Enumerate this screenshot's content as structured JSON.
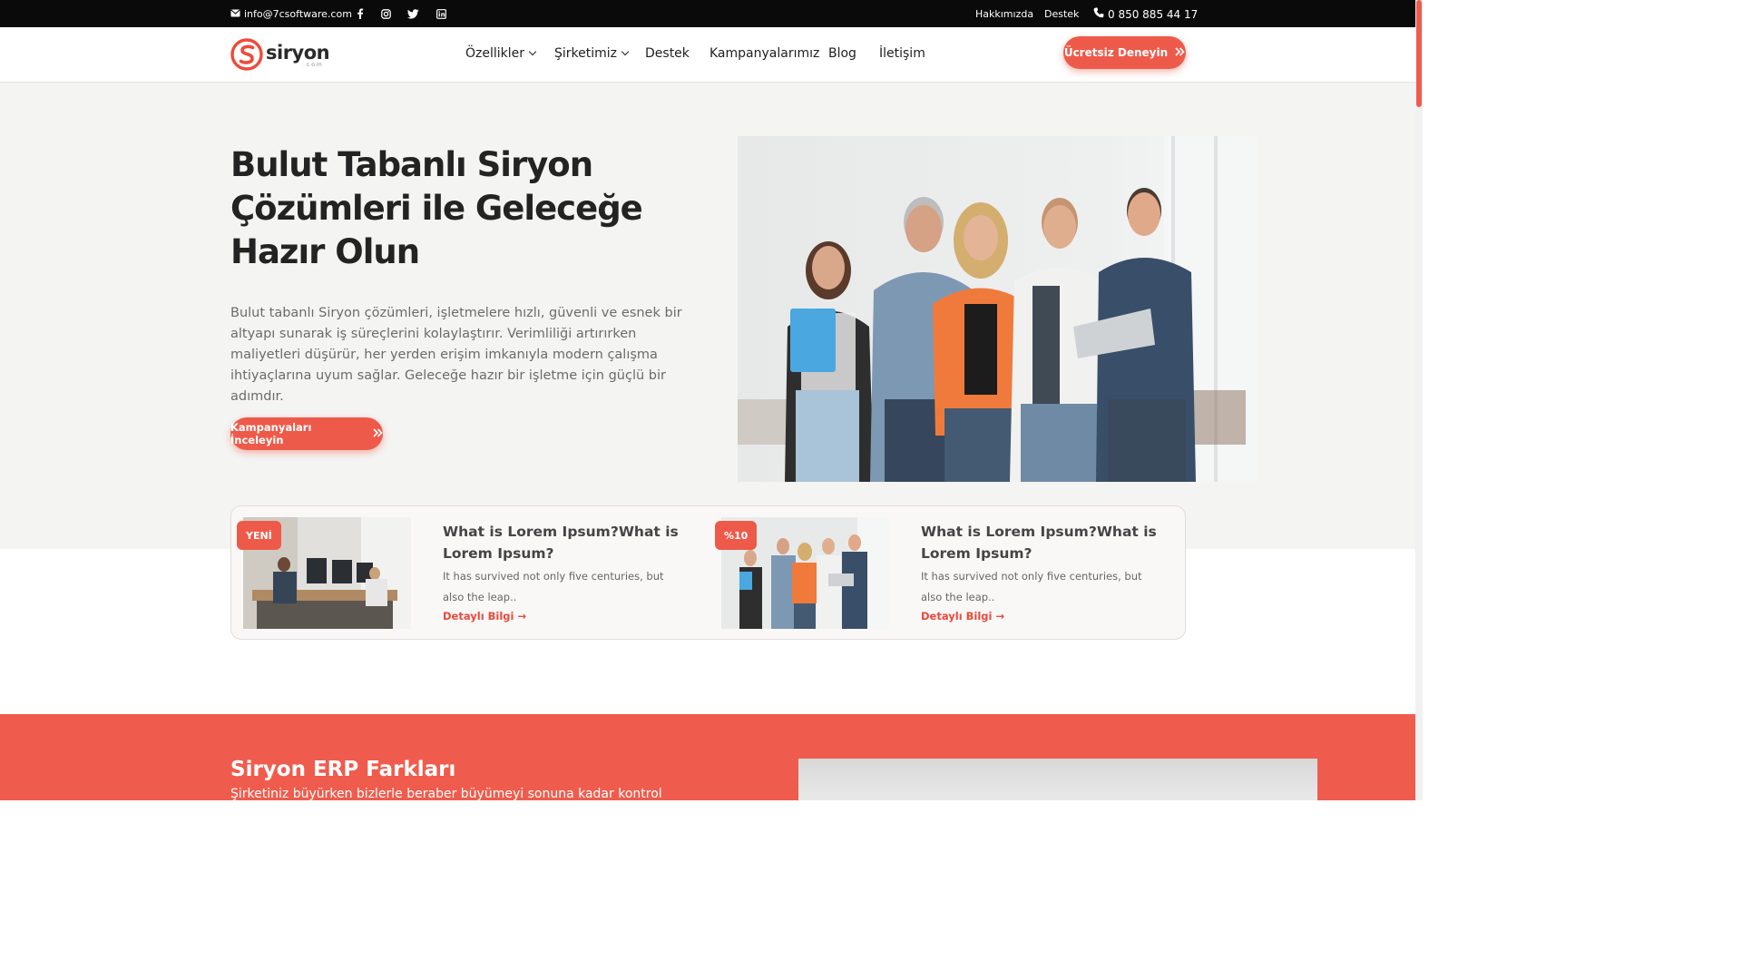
{
  "topbar": {
    "email": "info@7csoftware.com",
    "social": [
      "facebook-icon",
      "instagram-icon",
      "twitter-icon",
      "linkedin-icon"
    ],
    "links": [
      "Hakkımızda",
      "Destek"
    ],
    "phone": "0 850 885 44 17"
  },
  "header": {
    "logo_text": "siryon",
    "logo_sub": ".com",
    "nav": [
      {
        "label": "Özellikler",
        "dropdown": true
      },
      {
        "label": "Şirketimiz",
        "dropdown": true
      },
      {
        "label": "Destek",
        "dropdown": false
      },
      {
        "label": "Kampanyalarımız",
        "dropdown": false
      },
      {
        "label": "Blog",
        "dropdown": false
      },
      {
        "label": "İletişim",
        "dropdown": false
      }
    ],
    "cta": "Ücretsiz Deneyin"
  },
  "hero": {
    "title": "Bulut Tabanlı Siryon Çözümleri ile Geleceğe Hazır Olun",
    "description": "Bulut tabanlı Siryon çözümleri, işletmelere hızlı, güvenli ve esnek bir altyapı sunarak iş süreçlerini kolaylaştırır. Verimliliği artırırken maliyetleri düşürür, her yerden erişim imkanıyla modern çalışma ihtiyaçlarına uyum sağlar. Geleceğe hazır bir işletme için güçlü bir adımdır.",
    "cta": "Kampanyaları İnceleyin"
  },
  "cards": [
    {
      "badge": "YENİ",
      "title": "What is Lorem Ipsum?What is Lorem Ipsum?",
      "description": "It has survived not only five centuries, but also the leap..",
      "link": "Detaylı Bilgi →"
    },
    {
      "badge": "%10",
      "title": "What is Lorem Ipsum?What is Lorem Ipsum?",
      "description": "It has survived not only five centuries, but also the leap..",
      "link": "Detaylı Bilgi →"
    }
  ],
  "section": {
    "title": "Siryon ERP Farkları",
    "subtitle": "Şirketiniz büyürken bizlerle beraber büyümeyi sonuna kadar kontrol"
  },
  "colors": {
    "accent": "#ee5a4a",
    "topbar": "#0a0a0a",
    "hero_bg": "#f4f4f2"
  }
}
